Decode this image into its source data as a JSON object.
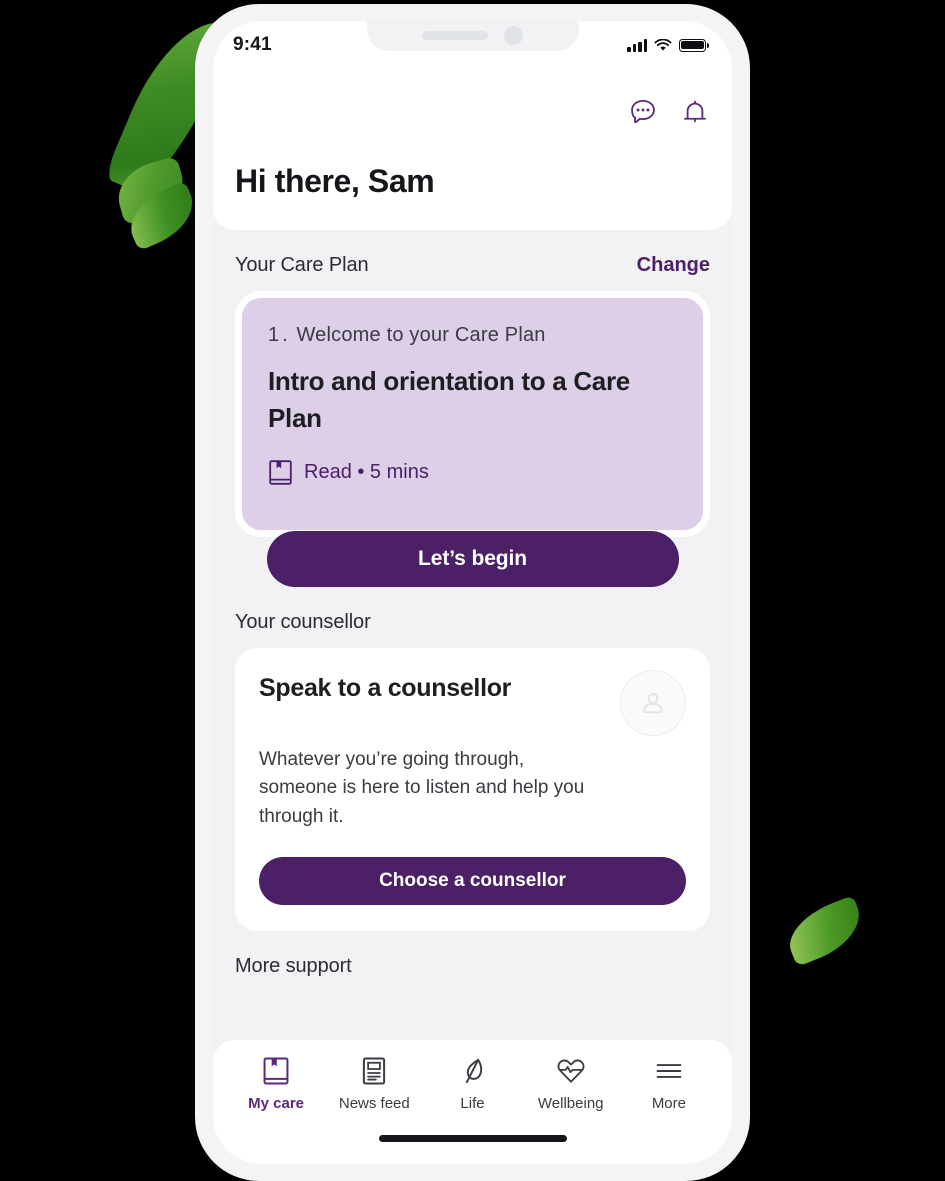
{
  "status_bar": {
    "time": "9:41",
    "signal_icon": "cellular-signal-icon",
    "wifi_icon": "wifi-icon",
    "battery_icon": "battery-icon"
  },
  "header": {
    "chat_icon": "chat-bubble-icon",
    "bell_icon": "notification-bell-icon",
    "greeting": "Hi there, Sam"
  },
  "care_plan_section": {
    "title": "Your Care Plan",
    "change_label": "Change",
    "card": {
      "step_number": "1.",
      "step_label": "Welcome to your Care Plan",
      "title": "Intro and orientation to a Care Plan",
      "meta_icon": "book-icon",
      "meta_text": "Read • 5 mins",
      "cta_label": "Let’s begin"
    }
  },
  "counsellor_section": {
    "title": "Your counsellor",
    "card": {
      "title": "Speak to a counsellor",
      "body": "Whatever you’re going through, someone is here to listen and help you through it.",
      "avatar_icon": "person-avatar-icon",
      "cta_label": "Choose a counsellor"
    }
  },
  "more_support_section": {
    "title": "More support"
  },
  "tabbar": {
    "items": [
      {
        "label": "My care",
        "icon": "book-icon",
        "active": true
      },
      {
        "label": "News feed",
        "icon": "news-document-icon",
        "active": false
      },
      {
        "label": "Life",
        "icon": "leaf-icon",
        "active": false
      },
      {
        "label": "Wellbeing",
        "icon": "heart-pulse-icon",
        "active": false
      },
      {
        "label": "More",
        "icon": "hamburger-menu-icon",
        "active": false
      }
    ]
  },
  "colors": {
    "brand_purple": "#4b2067",
    "active_tab_purple": "#5b2a7c",
    "card_lavender": "#ddcfe8",
    "screen_background": "#f2f2f5",
    "text_dark": "#1d1d22"
  }
}
